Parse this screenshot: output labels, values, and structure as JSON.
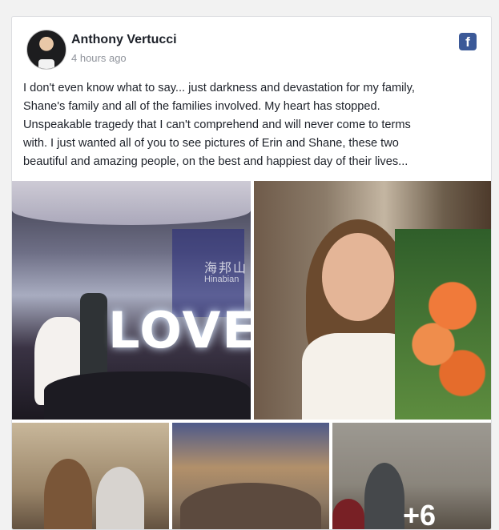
{
  "post": {
    "author": "Anthony Vertucci",
    "timestamp": "4 hours ago",
    "text": "I don't even know what to say... just darkness and devastation for my family,\nShane's family and all of the families involved. My heart has stopped.\nUnspeakable tragedy that I can't comprehend and will never come to terms\nwith. I just wanted all of you to see pictures of Erin and Shane, these two\nbeautiful and amazing people, on the best and happiest day of their lives...",
    "platform_icon": "facebook-icon"
  },
  "photos": {
    "photo1_sign": "LOVE",
    "more_count": "+6"
  },
  "watermark": {
    "main": "海邦山",
    "sub": "Hinabian"
  },
  "colors": {
    "facebook_blue": "#3b5998",
    "name_text": "#1d2129",
    "meta_text": "#90949c"
  }
}
